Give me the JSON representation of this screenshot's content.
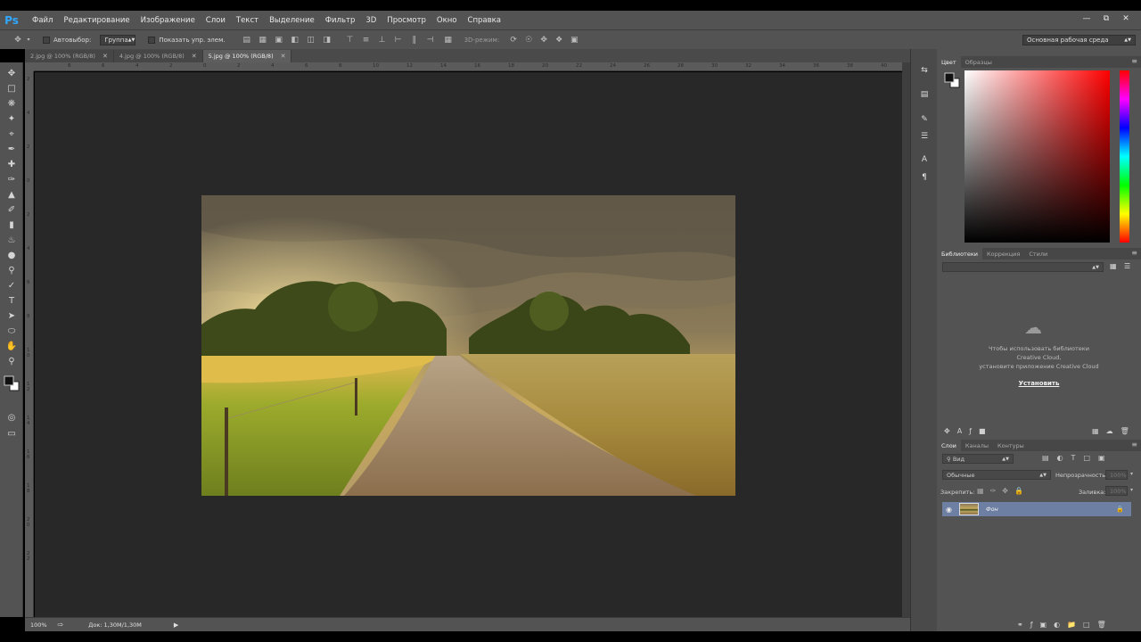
{
  "app": {
    "logo": "Ps"
  },
  "menu": [
    "Файл",
    "Редактирование",
    "Изображение",
    "Слои",
    "Текст",
    "Выделение",
    "Фильтр",
    "3D",
    "Просмотр",
    "Окно",
    "Справка"
  ],
  "window_controls": [
    "minimize-icon",
    "restore-icon",
    "close-icon"
  ],
  "options": {
    "autoselect_label": "Автовыбор:",
    "autoselect_value": "Группа",
    "show_controls_label": "Показать упр. элем.",
    "mode_3d_label": "3D-режим:",
    "workspace_value": "Основная рабочая среда"
  },
  "tabs": [
    {
      "label": "2.jpg @ 100% (RGB/8)",
      "active": false
    },
    {
      "label": "4.jpg @ 100% (RGB/8)",
      "active": false
    },
    {
      "label": "5.jpg @ 100% (RGB/8)",
      "active": true
    }
  ],
  "ruler_h": [
    "8",
    "6",
    "4",
    "2",
    "0",
    "2",
    "4",
    "6",
    "8",
    "10",
    "12",
    "14",
    "16",
    "18",
    "20",
    "22",
    "24",
    "26",
    "28",
    "30",
    "32",
    "34",
    "36",
    "38",
    "40"
  ],
  "ruler_v": [
    "2",
    "4",
    "2",
    "0",
    "2",
    "4",
    "6",
    "8",
    "1 0",
    "1 2",
    "1 4",
    "1 6",
    "1 8",
    "2 0",
    "2 2"
  ],
  "status": {
    "zoom": "100%",
    "doc": "Док: 1,30M/1,30M"
  },
  "color_panel": {
    "tabs": [
      "Цвет",
      "Образцы"
    ]
  },
  "library_panel": {
    "tabs": [
      "Библиотеки",
      "Коррекция",
      "Стили"
    ],
    "message": [
      "Чтобы использовать библиотеки",
      "Creative Cloud,",
      "установите приложение Creative Cloud"
    ],
    "install_label": "Установить"
  },
  "layers_panel": {
    "tabs": [
      "Слои",
      "Каналы",
      "Контуры"
    ],
    "filter_value": "Вид",
    "blend_mode": "Обычные",
    "opacity_label": "Непрозрачность:",
    "opacity_value": "100%",
    "lock_label": "Закрепить:",
    "fill_label": "Заливка:",
    "fill_value": "100%",
    "layer_name": "Фон"
  }
}
